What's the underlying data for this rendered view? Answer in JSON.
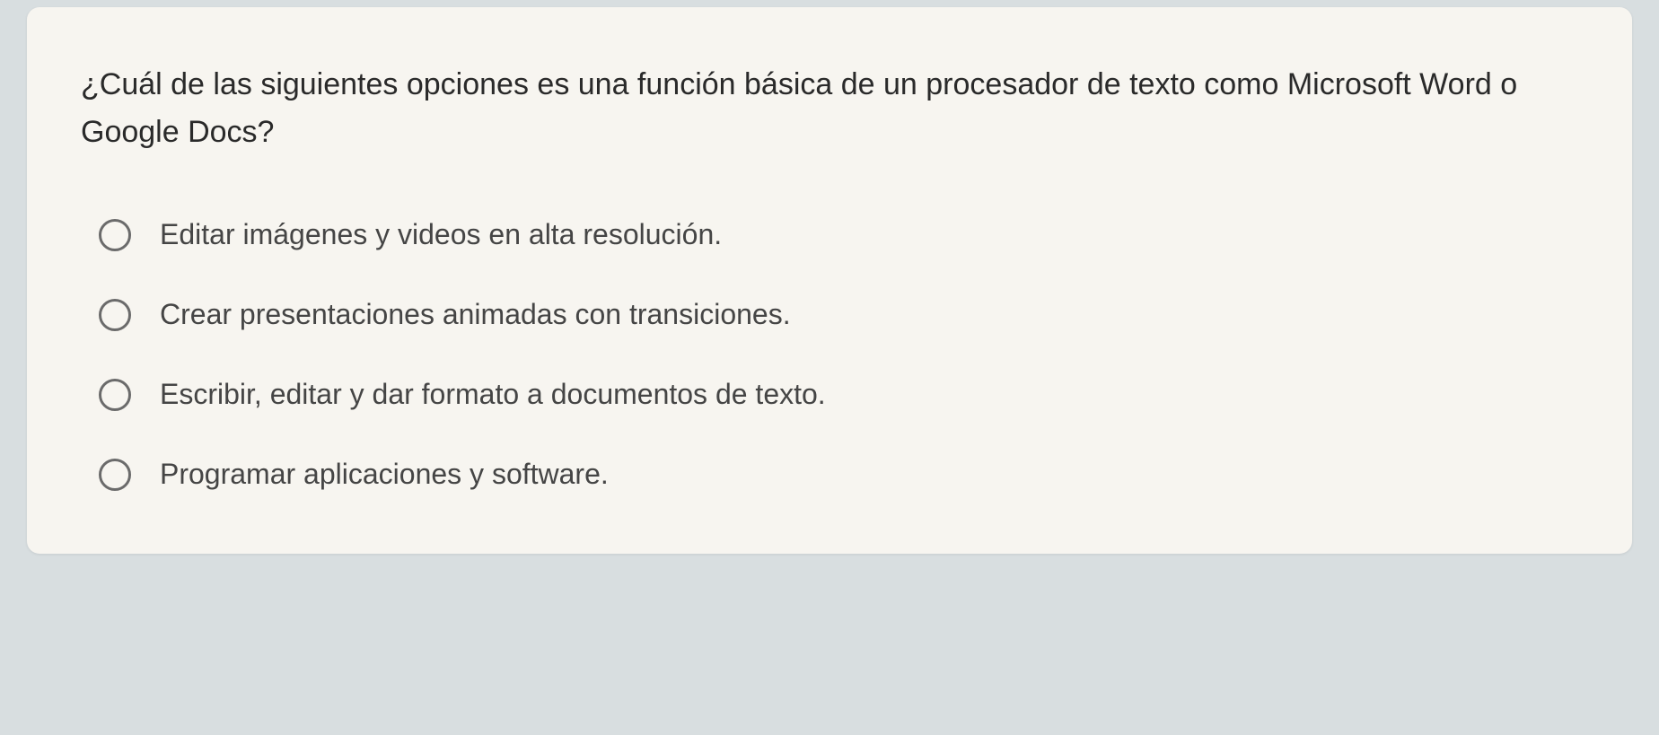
{
  "question": "¿Cuál de las siguientes opciones es una función básica de un procesador de texto como Microsoft Word o Google Docs?",
  "options": [
    {
      "label": "Editar imágenes y videos en alta resolución."
    },
    {
      "label": "Crear presentaciones animadas con transiciones."
    },
    {
      "label": "Escribir, editar y dar formato a documentos de texto."
    },
    {
      "label": "Programar aplicaciones y software."
    }
  ]
}
